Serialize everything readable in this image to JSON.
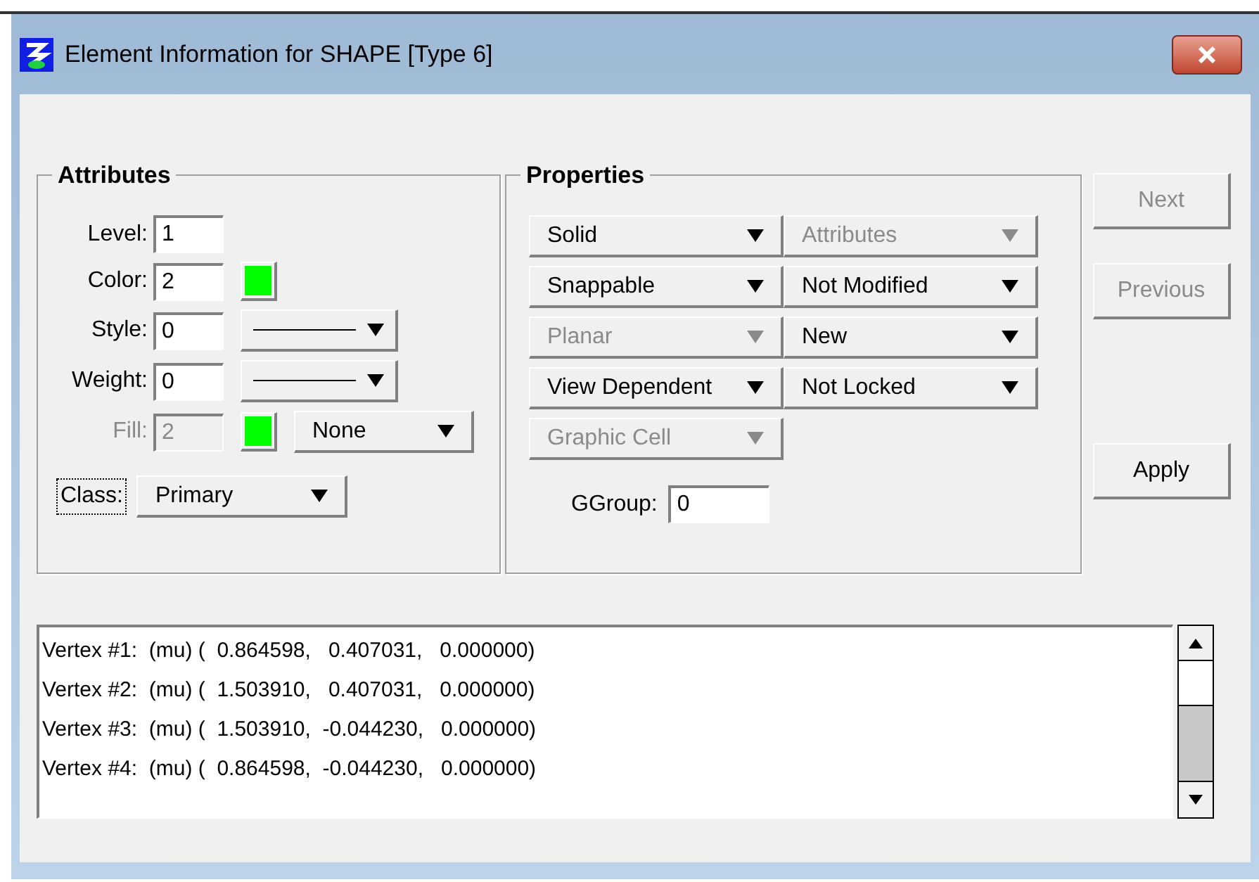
{
  "window": {
    "title": "Element Information for SHAPE [Type 6]"
  },
  "attributes": {
    "title": "Attributes",
    "rows": [
      {
        "label": "Level:",
        "value": "1",
        "disabled": false,
        "controls": []
      },
      {
        "label": "Color:",
        "value": "2",
        "disabled": false,
        "controls": [
          {
            "kind": "swatch",
            "color": "#00ff00"
          }
        ]
      },
      {
        "label": "Style:",
        "value": "0",
        "disabled": false,
        "controls": [
          {
            "kind": "line_dropdown"
          }
        ]
      },
      {
        "label": "Weight:",
        "value": "0",
        "disabled": false,
        "controls": [
          {
            "kind": "line_dropdown"
          }
        ]
      },
      {
        "label": "Fill:",
        "value": "2",
        "disabled": true,
        "controls": [
          {
            "kind": "swatch",
            "color": "#00ff00"
          },
          {
            "kind": "dropdown",
            "label": "None"
          }
        ]
      }
    ],
    "class": {
      "label": "Class:",
      "focused": true,
      "value": "Primary"
    }
  },
  "properties": {
    "title": "Properties",
    "dropdowns": [
      [
        {
          "label": "Solid",
          "disabled": false
        },
        {
          "label": "Attributes",
          "disabled": true
        }
      ],
      [
        {
          "label": "Snappable",
          "disabled": false
        },
        {
          "label": "Not Modified",
          "disabled": false
        }
      ],
      [
        {
          "label": "Planar",
          "disabled": true
        },
        {
          "label": "New",
          "disabled": false
        }
      ],
      [
        {
          "label": "View Dependent",
          "disabled": false
        },
        {
          "label": "Not Locked",
          "disabled": false
        }
      ],
      [
        {
          "label": "Graphic Cell",
          "disabled": true
        }
      ]
    ],
    "ggroup": {
      "label": "GGroup:",
      "value": "0"
    }
  },
  "buttons": [
    {
      "label": "Next",
      "disabled": true
    },
    {
      "label": "Previous",
      "disabled": true
    },
    {
      "label": "Apply",
      "disabled": false
    }
  ],
  "vertices": [
    "Vertex #1:  (mu) (  0.864598,   0.407031,   0.000000)",
    "Vertex #2:  (mu) (  1.503910,   0.407031,   0.000000)",
    "Vertex #3:  (mu) (  1.503910,  -0.044230,   0.000000)",
    "Vertex #4:  (mu) (  0.864598,  -0.044230,   0.000000)"
  ]
}
